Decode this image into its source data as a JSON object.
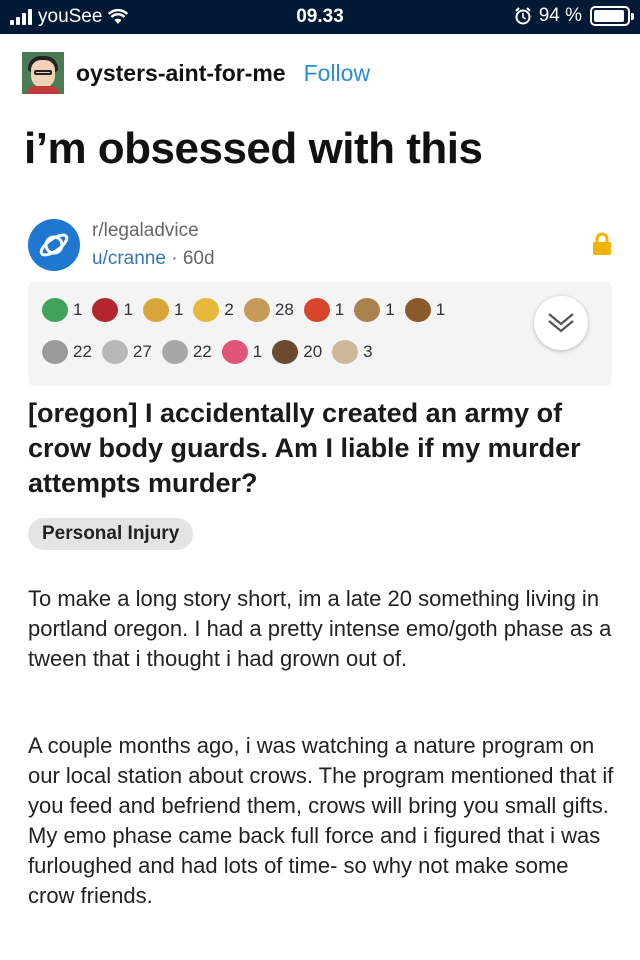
{
  "status_bar": {
    "carrier": "youSee",
    "time": "09.33",
    "battery": "94 %",
    "battery_level": 0.94
  },
  "blog": {
    "name": "oysters-aint-for-me",
    "follow": "Follow"
  },
  "post": {
    "title": "i’m obsessed with this"
  },
  "reddit": {
    "subreddit": "r/legaladvice",
    "user": "u/cranne",
    "separator": "·",
    "age": "60d",
    "awards_row1": [
      {
        "icon": "smiley-award-icon",
        "color": "#3fa35b",
        "count": "1"
      },
      {
        "icon": "heart-award-icon",
        "color": "#b3262e",
        "count": "1"
      },
      {
        "icon": "graduation-award-icon",
        "color": "#d9a43a",
        "count": "1"
      },
      {
        "icon": "medal-award-icon",
        "color": "#e6b93d",
        "count": "2"
      },
      {
        "icon": "hands-award-icon",
        "color": "#c89a5a",
        "count": "28"
      },
      {
        "icon": "crab-award-icon",
        "color": "#d8452c",
        "count": "1"
      },
      {
        "icon": "deer-award-icon",
        "color": "#a9824f",
        "count": "1"
      },
      {
        "icon": "burger-award-icon",
        "color": "#8b5a2b",
        "count": "1"
      }
    ],
    "awards_row2": [
      {
        "icon": "disguise-award-icon",
        "color": "#9b9b9b",
        "count": "22"
      },
      {
        "icon": "laughing-award-icon",
        "color": "#b8b8b8",
        "count": "27"
      },
      {
        "icon": "silver-award-icon",
        "color": "#a7a7a7",
        "count": "22"
      },
      {
        "icon": "wholesome-award-icon",
        "color": "#e0557a",
        "count": "1"
      },
      {
        "icon": "bear-award-icon",
        "color": "#6b4a2f",
        "count": "20"
      },
      {
        "icon": "cheers-award-icon",
        "color": "#d0b79a",
        "count": "3"
      }
    ],
    "title": "[oregon] I accidentally created an army of crow body guards. Am I liable if my murder attempts murder?",
    "flair": "Personal Injury",
    "paragraphs": [
      "To make a long story short, im a late 20 something living in portland oregon. I had a pretty intense emo/goth phase as a tween that i thought i had grown out of.",
      "A couple months ago, i was watching a nature program on our local station about crows. The program mentioned that if you feed and befriend them, crows will bring you small gifts. My emo phase came back full force and i figured that i was furloughed and had lots of time- so why not make some crow friends."
    ]
  },
  "colors": {
    "status_bar_bg": "#001935",
    "follow_blue": "#2a8cd6",
    "reddit_blue": "#1e78d2",
    "lock_yellow": "#f5b300"
  }
}
